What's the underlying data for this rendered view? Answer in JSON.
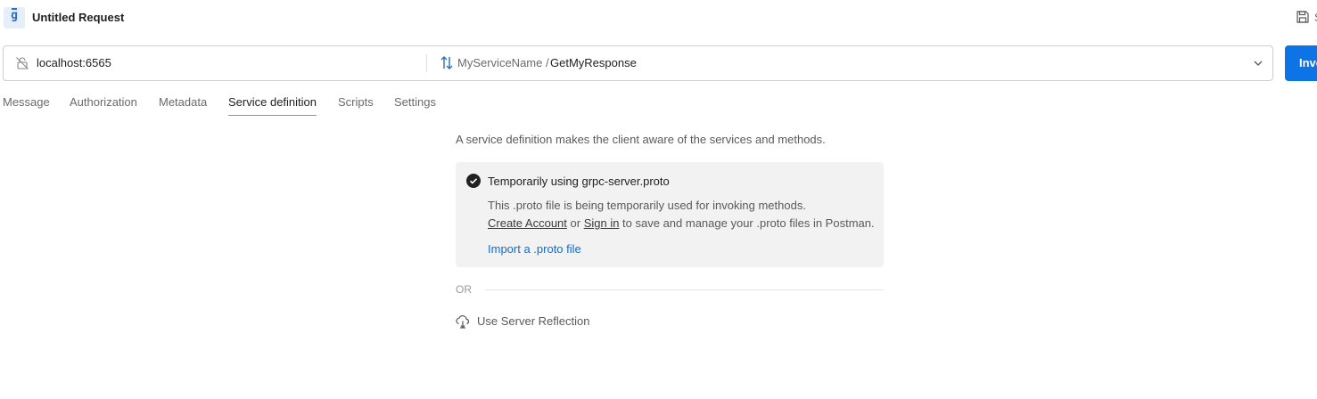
{
  "header": {
    "app_icon_glyph": "g",
    "title": "Untitled Request",
    "save_icon": "save-icon"
  },
  "request": {
    "host": "localhost:6565",
    "service": "MyServiceName /",
    "method": "GetMyResponse",
    "invoke_label": "Invo"
  },
  "tabs": [
    {
      "label": "Message"
    },
    {
      "label": "Authorization"
    },
    {
      "label": "Metadata"
    },
    {
      "label": "Service definition",
      "active": true
    },
    {
      "label": "Scripts"
    },
    {
      "label": "Settings"
    }
  ],
  "service_definition": {
    "intro": "A service definition makes the client aware of the services and methods.",
    "card": {
      "title": "Temporarily using grpc-server.proto",
      "line1": "This .proto file is being temporarily used for invoking methods.",
      "create_account": "Create Account",
      "or_text": " or ",
      "sign_in": "Sign in",
      "line2_tail": " to save and manage your .proto files in Postman.",
      "import_link": "Import a .proto file"
    },
    "or_label": "OR",
    "reflection_label": "Use Server Reflection"
  },
  "colors": {
    "accent": "#ff6c37",
    "primary": "#0c74e4",
    "link": "#0b6fd6"
  }
}
